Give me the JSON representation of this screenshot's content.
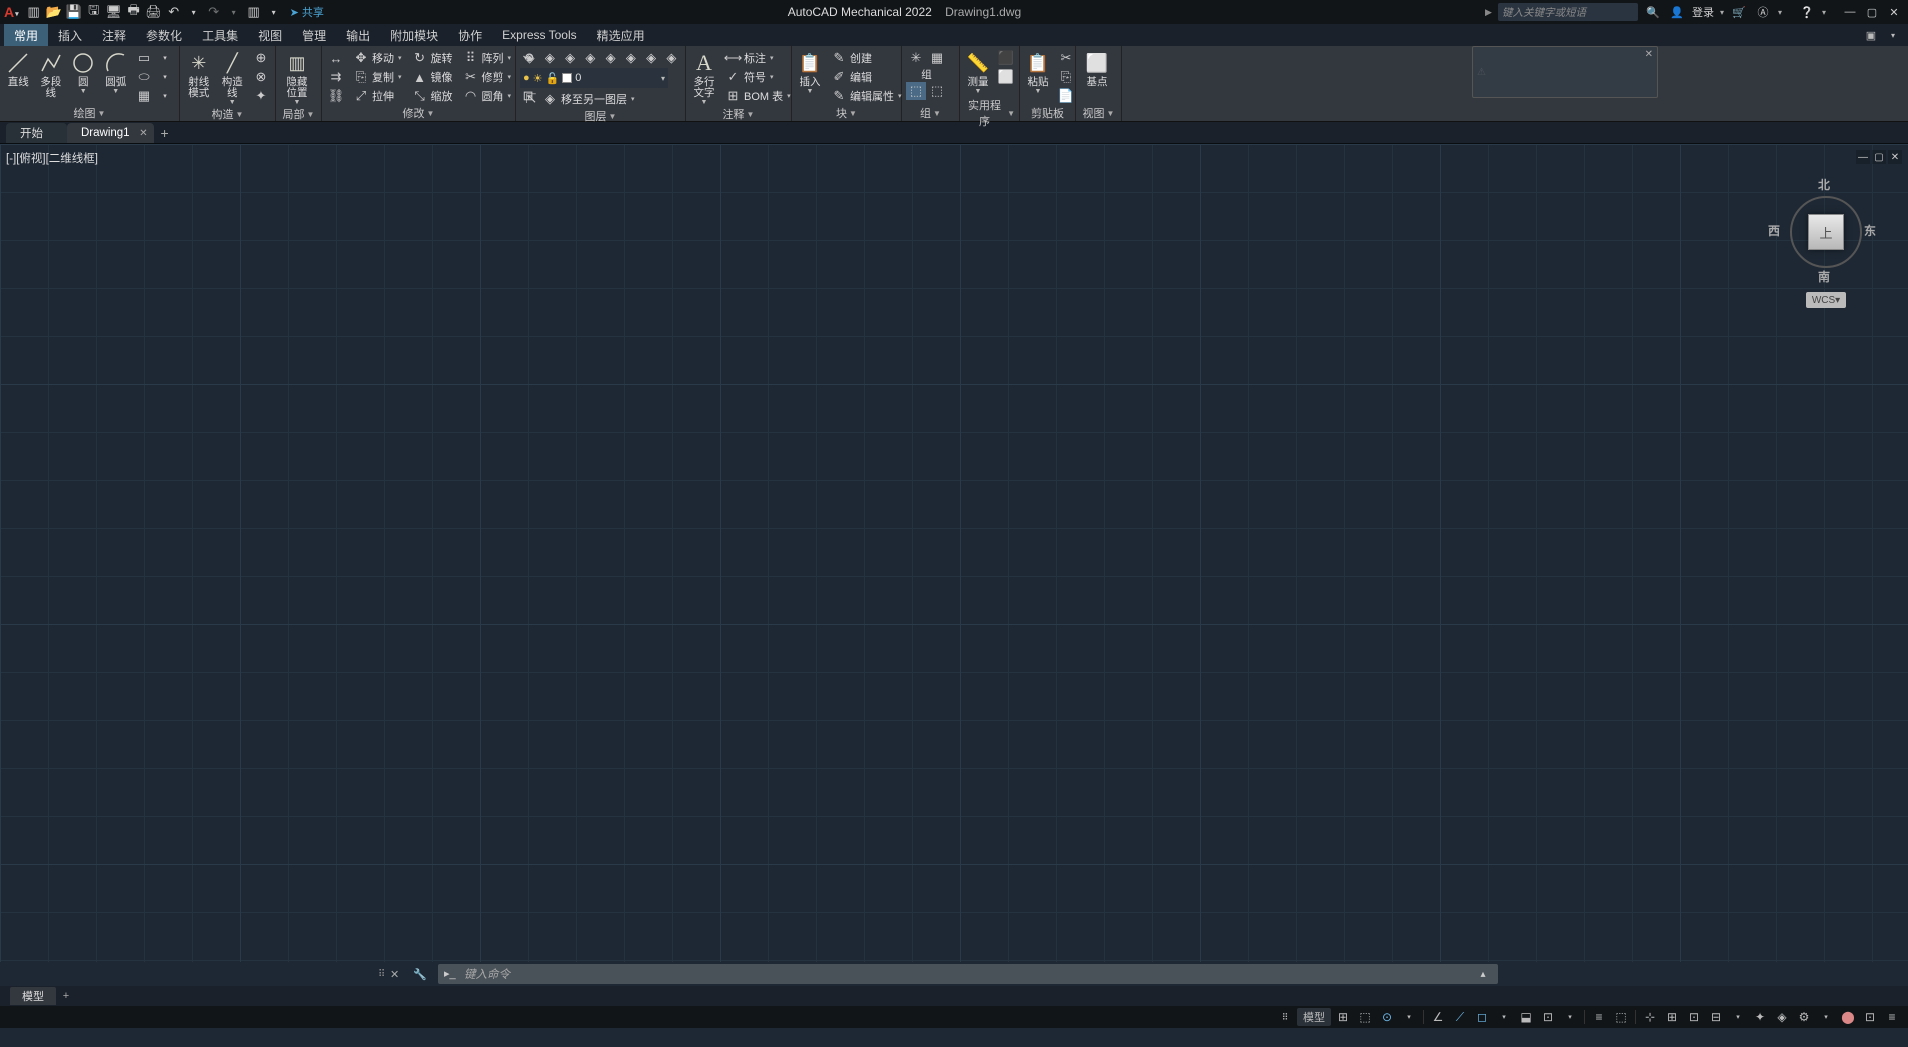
{
  "titlebar": {
    "app_name": "AutoCAD Mechanical 2022",
    "file_name": "Drawing1.dwg",
    "share": "共享",
    "search_placeholder": "键入关键字或短语",
    "login": "登录"
  },
  "menu": {
    "tabs": [
      "常用",
      "插入",
      "注释",
      "参数化",
      "工具集",
      "视图",
      "管理",
      "输出",
      "附加模块",
      "协作",
      "Express Tools",
      "精选应用"
    ],
    "active": 0
  },
  "ribbon": {
    "draw": {
      "title": "绘图",
      "line": "直线",
      "pline": "多段线",
      "circle": "圆",
      "arc": "圆弧"
    },
    "construct": {
      "title": "构造",
      "ray": "射线\n模式",
      "cline": "构造\n线"
    },
    "local": {
      "title": "局部",
      "hide": "隐藏\n位置"
    },
    "modify": {
      "title": "修改",
      "move": "移动",
      "copy": "复制",
      "stretch": "拉伸",
      "rotate": "旋转",
      "mirror": "镜像",
      "scale": "缩放",
      "array": "阵列",
      "trim": "修剪",
      "fillet": "圆角"
    },
    "layer": {
      "title": "图层",
      "current": "0",
      "moveto": "移至另一图层"
    },
    "annot": {
      "title": "注释",
      "mtext": "多行\n文字",
      "dim": "标注",
      "sym": "符号",
      "bom": "BOM 表"
    },
    "block": {
      "title": "块",
      "insert": "插入",
      "create": "创建",
      "edit": "编辑",
      "attr": "编辑属性"
    },
    "group": {
      "title": "组",
      "group": "组"
    },
    "util": {
      "title": "实用程序",
      "measure": "测量"
    },
    "clip": {
      "title": "剪贴板",
      "paste": "粘贴"
    },
    "view": {
      "title": "视图",
      "base": "基点"
    }
  },
  "filetabs": {
    "start": "开始",
    "drawing": "Drawing1"
  },
  "viewport": {
    "label": "[-][俯视][二维线框]"
  },
  "viewcube": {
    "top": "上",
    "n": "北",
    "s": "南",
    "e": "东",
    "w": "西",
    "wcs": "WCS"
  },
  "cmdline": {
    "prompt": "键入命令"
  },
  "bottom": {
    "model": "模型"
  },
  "status": {
    "model": "模型"
  }
}
